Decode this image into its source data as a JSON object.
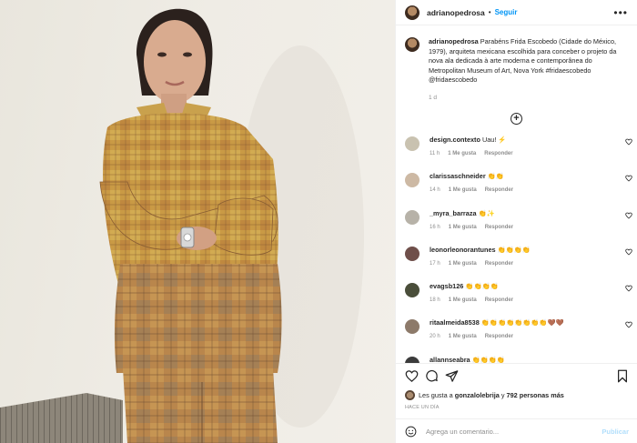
{
  "post": {
    "username": "adrianopedrosa",
    "separator": "•",
    "follow_label": "Seguir",
    "more_label": "•••",
    "caption_text": "Parabéns Frida Escobedo (Cidade do México, 1979), arquiteta mexicana escolhida para conceber o projeto da nova ala dedicada à arte moderna e contemporânea do Metropolitan Museum of Art, Nova York #fridaescobedo @fridaescobedo",
    "caption_time": "1 d",
    "load_more": "+"
  },
  "comments": [
    {
      "user": "design.contexto",
      "text": "Uau! ⚡",
      "time": "11 h",
      "likes": "1 Me gusta",
      "reply": "Responder",
      "avatar_color": "#c9c2b0"
    },
    {
      "user": "clarissaschneider",
      "text": "👏👏",
      "time": "14 h",
      "likes": "1 Me gusta",
      "reply": "Responder",
      "avatar_color": "#cdb9a4"
    },
    {
      "user": "_myra_barraza",
      "text": "👏✨",
      "time": "16 h",
      "likes": "1 Me gusta",
      "reply": "Responder",
      "avatar_color": "#b7b2a8"
    },
    {
      "user": "leonorleonorantunes",
      "text": "👏👏👏👏",
      "time": "17 h",
      "likes": "1 Me gusta",
      "reply": "Responder",
      "avatar_color": "#6f4f4a"
    },
    {
      "user": "evagsb126",
      "text": "👏👏👏👏",
      "time": "18 h",
      "likes": "1 Me gusta",
      "reply": "Responder",
      "avatar_color": "#4a4e3a"
    },
    {
      "user": "ritaalmeida8538",
      "text": "👏👏👏👏👏👏👏👏🤎🤎",
      "time": "20 h",
      "likes": "1 Me gusta",
      "reply": "Responder",
      "avatar_color": "#8d7a6a"
    },
    {
      "user": "allannseabra",
      "text": "👏👏👏👏",
      "time": "",
      "likes": "",
      "reply": "",
      "avatar_color": "#3b3b3b"
    }
  ],
  "actions": {
    "likes_prefix": "Les gusta a",
    "liked_by": "gonzalolebrija",
    "likes_join": "y",
    "likes_count": "792 personas más",
    "date": "HACE UN DÍA",
    "comment_placeholder": "Agrega un comentario...",
    "publish_label": "Publicar"
  },
  "colors": {
    "accent": "#0095f6",
    "publish_disabled": "#b2dffc",
    "muted": "#8e8e8e"
  },
  "icons": [
    "more-icon",
    "plus-circle-icon",
    "heart-icon",
    "comment-icon",
    "share-icon",
    "bookmark-icon",
    "emoji-icon"
  ]
}
